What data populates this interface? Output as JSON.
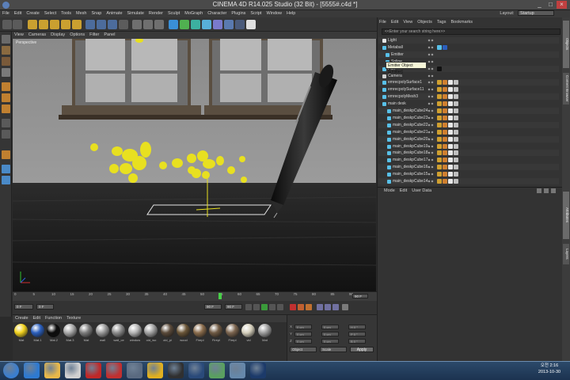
{
  "window": {
    "title": "CINEMA 4D R14.025 Studio (32 Bit) - [5555#.c4d *]",
    "controls": [
      "_",
      "□",
      "×"
    ]
  },
  "menu": [
    "File",
    "Edit",
    "Create",
    "Select",
    "Tools",
    "Mesh",
    "Snap",
    "Animate",
    "Simulate",
    "Render",
    "Sculpt",
    "MoGraph",
    "Character",
    "Plugins",
    "Script",
    "Window",
    "Help"
  ],
  "layout": {
    "label": "Layout:",
    "value": "Startup"
  },
  "viewport": {
    "menu": [
      "View",
      "Cameras",
      "Display",
      "Options",
      "Filter",
      "Panel"
    ],
    "label": "Perspective"
  },
  "timeline": {
    "ticks": [
      "0",
      "5",
      "10",
      "15",
      "20",
      "25",
      "30",
      "35",
      "40",
      "45",
      "50",
      "55",
      "60",
      "65",
      "70",
      "75",
      "80",
      "85",
      "90"
    ],
    "end_field": "90 F",
    "start_field": "0 F",
    "min_field": "0 F",
    "max_field": "90 F",
    "max2_field": "90 F"
  },
  "material_manager": {
    "menu": [
      "Create",
      "Edit",
      "Function",
      "Texture"
    ],
    "materials": [
      {
        "name": "Mat",
        "color": "#f2d21e"
      },
      {
        "name": "Mat.1",
        "color": "#2b5fbd"
      },
      {
        "name": "Mat.2",
        "color": "#0c0c0c"
      },
      {
        "name": "Mat.3",
        "color": "#a8a8a8"
      },
      {
        "name": "Mat",
        "color": "#7d7d7d"
      },
      {
        "name": "wall",
        "color": "#9a9a9a"
      },
      {
        "name": "wall_ce",
        "color": "#8c8c8c"
      },
      {
        "name": "window",
        "color": "#b5b5b5"
      },
      {
        "name": "old_wo",
        "color": "#a1a1a1"
      },
      {
        "name": "old_pi",
        "color": "#5a4a3a"
      },
      {
        "name": "wood",
        "color": "#6b5638"
      },
      {
        "name": "Firepl",
        "color": "#8a6c4c"
      },
      {
        "name": "Firepl",
        "color": "#6f5a44"
      },
      {
        "name": "Firepl",
        "color": "#7d6650"
      },
      {
        "name": "vid",
        "color": "#d6d0bd"
      },
      {
        "name": "Mat",
        "color": "#9e9e9e"
      }
    ]
  },
  "coordinates": {
    "rows": [
      {
        "axis": "X",
        "pos": "0 cm",
        "size": "0 cm",
        "rot": "H 0 °"
      },
      {
        "axis": "Y",
        "pos": "0 cm",
        "size": "0 cm",
        "rot": "P 0 °"
      },
      {
        "axis": "Z",
        "pos": "0 cm",
        "size": "0 cm",
        "rot": "B 0 °"
      }
    ],
    "mode": "Object",
    "size_mode": "Scale",
    "apply_label": "Apply"
  },
  "object_manager": {
    "menu": [
      "File",
      "Edit",
      "View",
      "Objects",
      "Tags",
      "Bookmarks"
    ],
    "search_placeholder": "<<Enter your search string here>>",
    "tooltip": "Emitter Object [Emitter]",
    "rows": [
      {
        "name": "Light",
        "icon_color": "#e6e6e6",
        "indent": 0
      },
      {
        "name": "Metaball",
        "icon_color": "#58c0e8",
        "indent": 0
      },
      {
        "name": "Emitter",
        "icon_color": "#58c0e8",
        "indent": 4
      },
      {
        "name": "Spline",
        "icon_color": "#58c0e8",
        "indent": 4
      },
      {
        "name": "Pen",
        "icon_color": "#58c0e8",
        "indent": 0
      },
      {
        "name": "Camera",
        "icon_color": "#d0d0d0",
        "indent": 0
      },
      {
        "name": "emrecpolySurface1",
        "icon_color": "#58c0e8",
        "indent": 0
      },
      {
        "name": "emrecpolySurface11",
        "icon_color": "#58c0e8",
        "indent": 0
      },
      {
        "name": "emrecpolyMesh3",
        "icon_color": "#58c0e8",
        "indent": 0
      },
      {
        "name": "main desk",
        "icon_color": "#58c0e8",
        "indent": 0
      },
      {
        "name": "main_deskpCube24",
        "icon_color": "#58c0e8",
        "indent": 6
      },
      {
        "name": "main_deskpCube23",
        "icon_color": "#58c0e8",
        "indent": 6
      },
      {
        "name": "main_deskpCube22",
        "icon_color": "#58c0e8",
        "indent": 6
      },
      {
        "name": "main_deskpCube21",
        "icon_color": "#58c0e8",
        "indent": 6
      },
      {
        "name": "main_deskpCube20",
        "icon_color": "#58c0e8",
        "indent": 6
      },
      {
        "name": "main_deskpCube19",
        "icon_color": "#58c0e8",
        "indent": 6
      },
      {
        "name": "main_deskpCube18",
        "icon_color": "#58c0e8",
        "indent": 6
      },
      {
        "name": "main_deskpCube17",
        "icon_color": "#58c0e8",
        "indent": 6
      },
      {
        "name": "main_deskpCube16",
        "icon_color": "#58c0e8",
        "indent": 6
      },
      {
        "name": "main_deskpCube15",
        "icon_color": "#58c0e8",
        "indent": 6
      },
      {
        "name": "main_deskpCube14",
        "icon_color": "#58c0e8",
        "indent": 6
      }
    ]
  },
  "attribute_manager": {
    "menu": [
      "Mode",
      "Edit",
      "User Data"
    ]
  },
  "right_tabs": [
    "Objects",
    "Content Browser",
    "Structure",
    "Attributes",
    "Layers"
  ],
  "taskbar": {
    "apps": [
      {
        "name": "start",
        "color": "#3a7ed0"
      },
      {
        "name": "ie",
        "color": "#2e7ad1"
      },
      {
        "name": "explorer",
        "color": "#e8b84a"
      },
      {
        "name": "outlook",
        "color": "#d0d0d0"
      },
      {
        "name": "recorder",
        "color": "#c02828"
      },
      {
        "name": "magnet",
        "color": "#c03030"
      },
      {
        "name": "webcam",
        "color": "#5a6a80"
      },
      {
        "name": "chrome",
        "color": "#e0b020"
      },
      {
        "name": "media",
        "color": "#303030"
      },
      {
        "name": "cinema4d",
        "color": "#2a4a7a"
      },
      {
        "name": "tool",
        "color": "#5aa060"
      },
      {
        "name": "image",
        "color": "#6688aa"
      },
      {
        "name": "photoshop",
        "color": "#1c3a6a"
      }
    ],
    "time": "오전 2:16",
    "date": "2013-10-30"
  }
}
